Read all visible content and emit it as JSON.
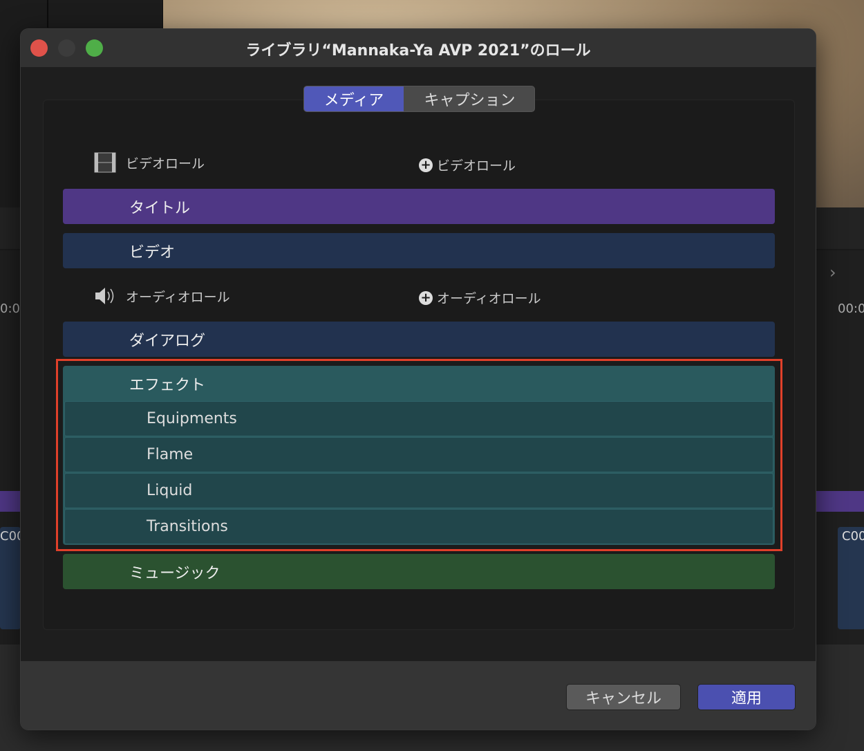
{
  "window": {
    "title": "ライブラリ“Mannaka-Ya AVP 2021”のロール"
  },
  "tabs": [
    {
      "label": "メディア",
      "selected": true
    },
    {
      "label": "キャプション",
      "selected": false
    }
  ],
  "video_section": {
    "label": "ビデオロール",
    "add_label": "ビデオロール",
    "icon": "film-icon"
  },
  "video_roles": [
    {
      "label": "タイトル",
      "color": "#4f3785"
    },
    {
      "label": "ビデオ",
      "color": "#22324f"
    }
  ],
  "audio_section": {
    "label": "オーディオロール",
    "add_label": "オーディオロール",
    "icon": "speaker-icon"
  },
  "audio_roles": {
    "dialogue": {
      "label": "ダイアログ",
      "color": "#22324f"
    },
    "effects": {
      "label": "エフェクト",
      "color": "#2a5a5e",
      "subroles": [
        "Equipments",
        "Flame",
        "Liquid",
        "Transitions"
      ]
    },
    "music": {
      "label": "ミュージック",
      "color": "#2b5230"
    }
  },
  "buttons": {
    "cancel": "キャンセル",
    "apply": "適用"
  },
  "background": {
    "timecode_left": "0:0",
    "timecode_right": "00:0",
    "clip_left": "C00",
    "clip_right": "C00"
  }
}
